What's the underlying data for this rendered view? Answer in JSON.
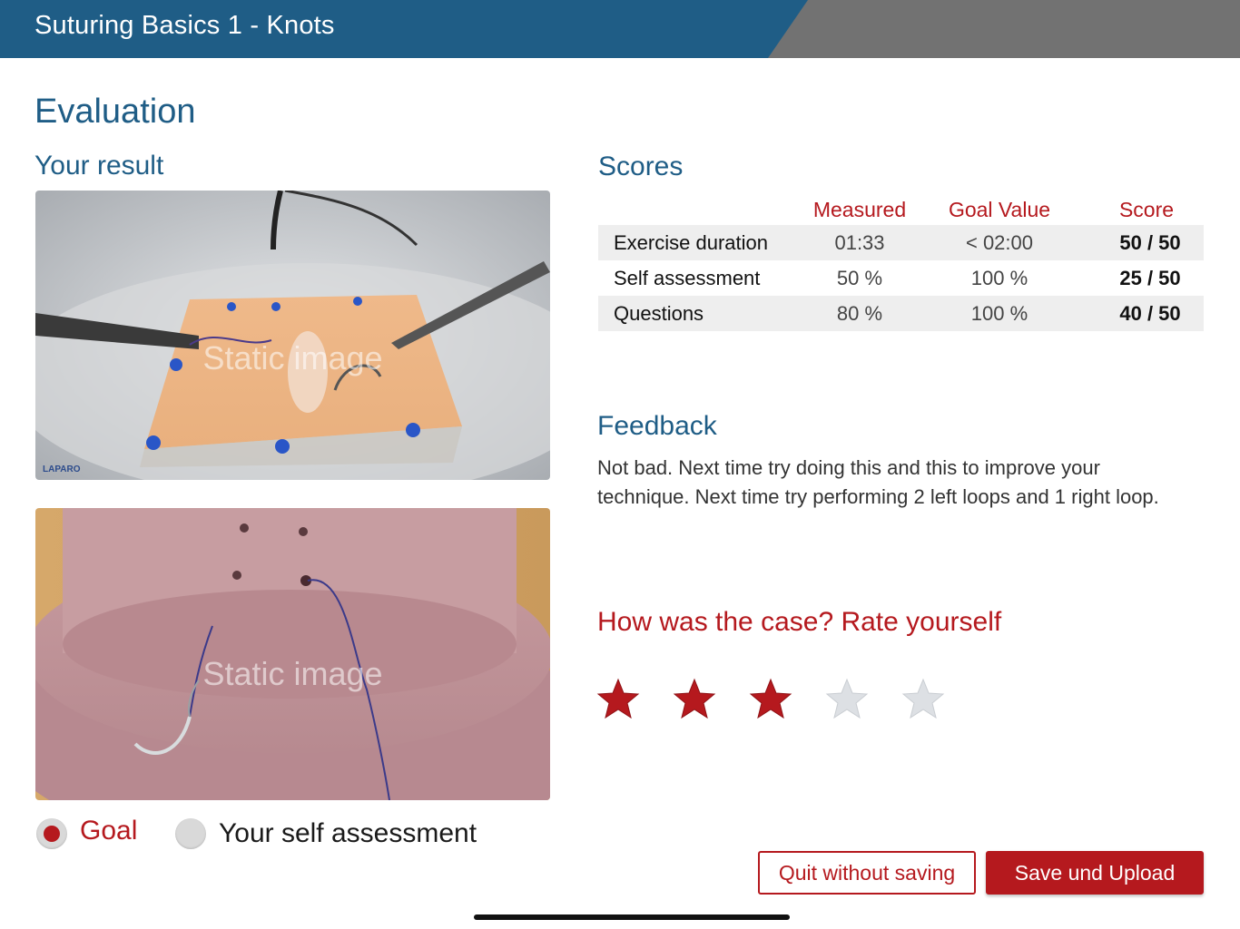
{
  "header": {
    "title": "Suturing Basics 1 - Knots"
  },
  "page": {
    "title": "Evaluation"
  },
  "result": {
    "title": "Your result",
    "images": [
      {
        "watermark": "Static image",
        "brand": "LAPARO"
      },
      {
        "watermark": "Static image"
      }
    ],
    "view_options": [
      {
        "label": "Goal",
        "selected": true
      },
      {
        "label": "Your self assessment",
        "selected": false
      }
    ]
  },
  "scores": {
    "title": "Scores",
    "columns": [
      "Measured",
      "Goal Value",
      "Score"
    ],
    "rows": [
      {
        "name": "Exercise duration",
        "measured": "01:33",
        "goal": "< 02:00",
        "score": "50 / 50"
      },
      {
        "name": "Self assessment",
        "measured": "50 %",
        "goal": "100 %",
        "score": "25 / 50"
      },
      {
        "name": "Questions",
        "measured": "80 %",
        "goal": "100 %",
        "score": "40 / 50"
      }
    ]
  },
  "feedback": {
    "title": "Feedback",
    "text": "Not bad. Next time try doing this and this to improve your technique.  Next time try performing 2 left loops and 1 right loop."
  },
  "rating": {
    "title": "How was the case? Rate yourself",
    "value": 3,
    "max": 5,
    "active_color": "#b5191e",
    "inactive_color": "#dde0e4"
  },
  "actions": {
    "quit_label": "Quit without saving",
    "save_label": "Save und Upload"
  },
  "colors": {
    "brand_blue": "#1f5d86",
    "accent_red": "#b5191e",
    "header_gray": "#727272"
  }
}
